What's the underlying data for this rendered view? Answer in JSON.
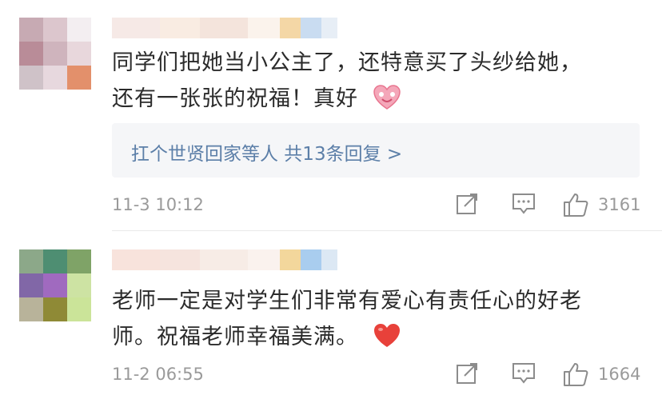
{
  "comments": [
    {
      "text_line1": "同学们把她当小公主了，还特意买了头纱给她，",
      "text_line2": "还有一张张的祝福！真好",
      "emoji": "heart-bear-emoji",
      "reply_label": "扛个世贤回家等人 共13条回复 >",
      "time": "11-3 10:12",
      "likes": "3161"
    },
    {
      "text_line1": "老师一定是对学生们非常有爱心有责任心的好老",
      "text_line2": "师。祝福老师幸福美满。",
      "emoji": "red-heart-emoji",
      "time": "11-2 06:55",
      "likes": "1664"
    }
  ],
  "colors": {
    "text": "#2b2b2b",
    "link": "#5c7fa8",
    "meta": "#9a9a9a",
    "reply_bg": "#f5f6f8",
    "heart": "#e8413a"
  }
}
